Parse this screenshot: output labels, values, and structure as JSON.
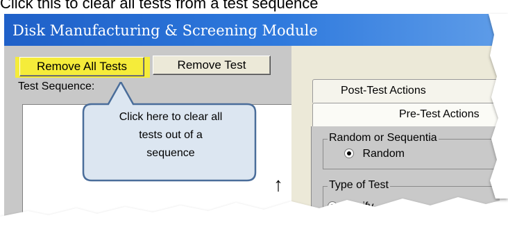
{
  "caption": "Click this to clear all tests from a test sequence",
  "window": {
    "title": "Disk Manufacturing & Screening Module"
  },
  "toolbar": {
    "remove_all_label": "Remove All Tests",
    "remove_label": "Remove Test"
  },
  "sequence": {
    "label": "Test Sequence:",
    "scroll_up_glyph": "↑"
  },
  "callout": {
    "lines": [
      "Click here to clear all",
      "tests out of a",
      "sequence"
    ]
  },
  "tabs": {
    "post_test": "Post-Test Actions",
    "pre_test": "Pre-Test Actions"
  },
  "pre_test_panel": {
    "random_group": {
      "legend": "Random or Sequentia",
      "options": [
        {
          "label": "Random",
          "selected": true
        }
      ]
    },
    "type_group": {
      "legend": "Type of Test",
      "options": [
        {
          "label": "Verify",
          "selected": true
        }
      ]
    }
  },
  "colors": {
    "highlight": "#f5ec3a",
    "callout_fill": "#dce6f1",
    "callout_border": "#4a6d9a",
    "titlebar": "#2e79dd"
  }
}
